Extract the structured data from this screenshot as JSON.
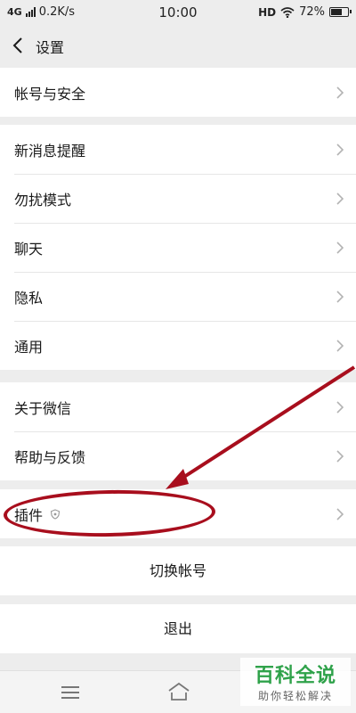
{
  "status_bar": {
    "network": "4G",
    "speed": "0.2K/s",
    "time": "10:00",
    "hd": "HD",
    "battery": "72%",
    "battery_level": 0.72
  },
  "nav": {
    "title": "设置"
  },
  "groups": [
    {
      "items": [
        {
          "label": "帐号与安全"
        }
      ]
    },
    {
      "items": [
        {
          "label": "新消息提醒"
        },
        {
          "label": "勿扰模式"
        },
        {
          "label": "聊天"
        },
        {
          "label": "隐私"
        },
        {
          "label": "通用"
        }
      ]
    },
    {
      "items": [
        {
          "label": "关于微信"
        },
        {
          "label": "帮助与反馈"
        }
      ]
    },
    {
      "items": [
        {
          "label": "插件"
        }
      ]
    }
  ],
  "buttons": {
    "switch_account": "切换帐号",
    "logout": "退出"
  },
  "watermark": {
    "title": "百科全说",
    "subtitle": "助你轻松解决"
  },
  "colors": {
    "annotation": "#a80e1d",
    "background": "#ededed",
    "watermark_green": "#2fa24a"
  }
}
